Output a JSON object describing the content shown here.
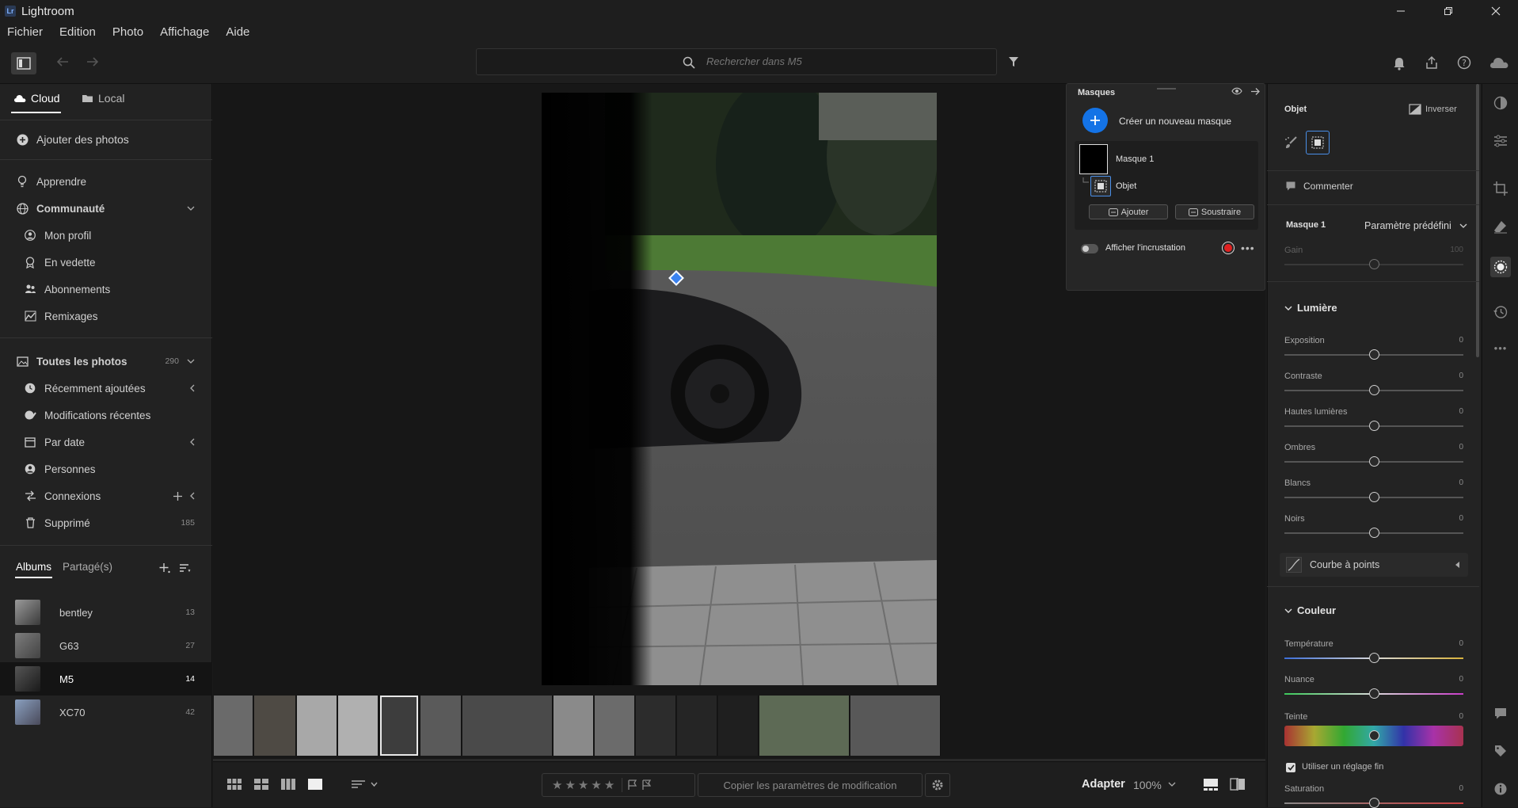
{
  "app": {
    "title": "Lightroom",
    "logo": "Lr"
  },
  "menu": [
    "Fichier",
    "Edition",
    "Photo",
    "Affichage",
    "Aide"
  ],
  "search": {
    "placeholder": "Rechercher dans M5"
  },
  "sidebar": {
    "tabs": {
      "cloud": "Cloud",
      "local": "Local"
    },
    "add_photos": "Ajouter des photos",
    "learn": "Apprendre",
    "community": {
      "label": "Communauté",
      "items": [
        "Mon profil",
        "En vedette",
        "Abonnements",
        "Remixages"
      ]
    },
    "all_photos": {
      "label": "Toutes les photos",
      "count": "290"
    },
    "library": [
      {
        "label": "Récemment ajoutées"
      },
      {
        "label": "Modifications récentes"
      },
      {
        "label": "Par date"
      },
      {
        "label": "Personnes"
      },
      {
        "label": "Connexions"
      },
      {
        "label": "Supprimé",
        "count": "185"
      }
    ],
    "albums_tabs": {
      "albums": "Albums",
      "shared": "Partagé(s)"
    },
    "albums": [
      {
        "name": "bentley",
        "count": "13"
      },
      {
        "name": "G63",
        "count": "27"
      },
      {
        "name": "M5",
        "count": "14"
      },
      {
        "name": "XC70",
        "count": "42"
      }
    ]
  },
  "masks_panel": {
    "title": "Masques",
    "create_label": "Créer un nouveau masque",
    "mask_name": "Masque 1",
    "component_name": "Objet",
    "add_label": "Ajouter",
    "subtract_label": "Soustraire",
    "overlay_label": "Afficher l'incrustation"
  },
  "right_panel": {
    "mask_type": "Objet",
    "invert_label": "Inverser",
    "comment_label": "Commenter",
    "mask_name": "Masque 1",
    "preset_label": "Paramètre prédéfini",
    "gain": {
      "label": "Gain",
      "value": "100"
    },
    "light": {
      "title": "Lumière",
      "sliders": [
        {
          "label": "Exposition",
          "value": "0"
        },
        {
          "label": "Contraste",
          "value": "0"
        },
        {
          "label": "Hautes lumières",
          "value": "0"
        },
        {
          "label": "Ombres",
          "value": "0"
        },
        {
          "label": "Blancs",
          "value": "0"
        },
        {
          "label": "Noirs",
          "value": "0"
        }
      ],
      "curve_label": "Courbe à points"
    },
    "color": {
      "title": "Couleur",
      "sliders": [
        {
          "label": "Température",
          "value": "0"
        },
        {
          "label": "Nuance",
          "value": "0"
        },
        {
          "label": "Teinte",
          "value": "0"
        }
      ],
      "fine_adjust_label": "Utiliser un réglage fin",
      "saturation": {
        "label": "Saturation",
        "value": "0"
      }
    }
  },
  "bottom": {
    "copy_settings": "Copier les paramètres de modification",
    "fit_label": "Adapter",
    "zoom": "100%"
  },
  "colors": {
    "accent": "#1473e6",
    "panel": "#232323",
    "canvas": "#171717"
  }
}
